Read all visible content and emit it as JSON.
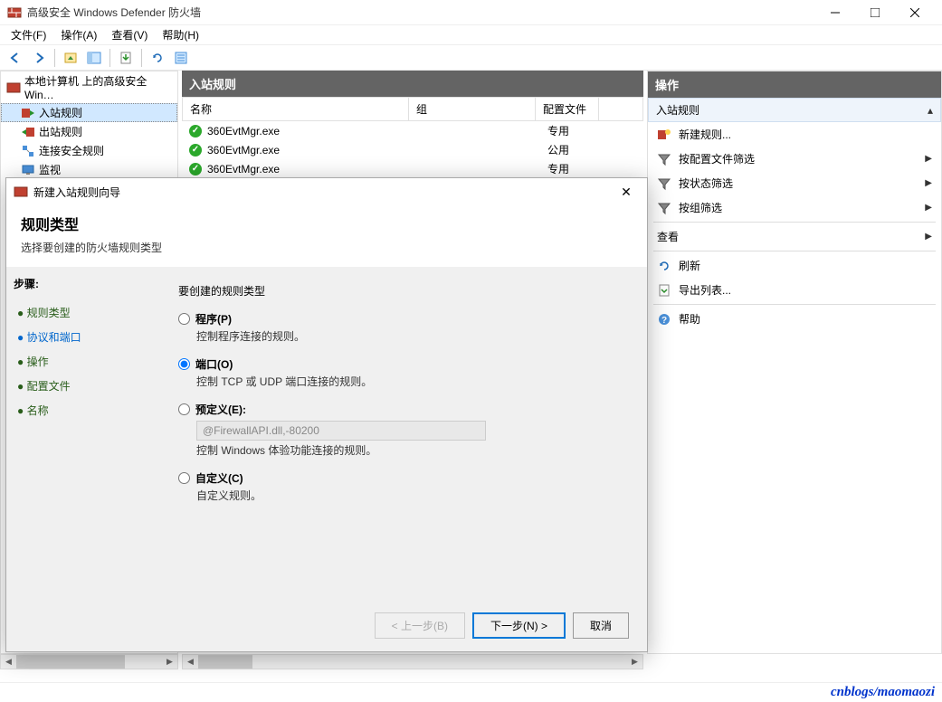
{
  "window": {
    "title": "高级安全 Windows Defender 防火墙"
  },
  "menu": {
    "file": "文件(F)",
    "action": "操作(A)",
    "view": "查看(V)",
    "help": "帮助(H)"
  },
  "tree": {
    "root": "本地计算机 上的高级安全 Win…",
    "inbound": "入站规则",
    "outbound": "出站规则",
    "connsec": "连接安全规则",
    "monitor": "监视"
  },
  "center": {
    "header": "入站规则",
    "cols": {
      "name": "名称",
      "group": "组",
      "profile": "配置文件"
    },
    "rows": [
      {
        "name": "360EvtMgr.exe",
        "group": "",
        "profile": "专用"
      },
      {
        "name": "360EvtMgr.exe",
        "group": "",
        "profile": "公用"
      },
      {
        "name": "360EvtMgr.exe",
        "group": "",
        "profile": "专用"
      }
    ]
  },
  "actions": {
    "header": "操作",
    "section": "入站规则",
    "items": {
      "newrule": "新建规则...",
      "filterprofile": "按配置文件筛选",
      "filterstate": "按状态筛选",
      "filtergroup": "按组筛选",
      "view": "查看",
      "refresh": "刷新",
      "export": "导出列表...",
      "help": "帮助"
    }
  },
  "wizard": {
    "title": "新建入站规则向导",
    "heading": "规则类型",
    "subheading": "选择要创建的防火墙规则类型",
    "steps_label": "步骤:",
    "steps": {
      "ruletype": "规则类型",
      "protocol": "协议和端口",
      "operation": "操作",
      "profile": "配置文件",
      "name": "名称"
    },
    "prompt": "要创建的规则类型",
    "options": {
      "program": {
        "label": "程序(P)",
        "desc": "控制程序连接的规则。"
      },
      "port": {
        "label": "端口(O)",
        "desc": "控制 TCP 或 UDP 端口连接的规则。"
      },
      "predefined": {
        "label": "预定义(E):",
        "dropdown": "@FirewallAPI.dll,-80200",
        "desc": "控制 Windows 体验功能连接的规则。"
      },
      "custom": {
        "label": "自定义(C)",
        "desc": "自定义规则。"
      }
    },
    "buttons": {
      "back": "< 上一步(B)",
      "next": "下一步(N) >",
      "cancel": "取消"
    }
  },
  "watermark": "cnblogs/maomaozi"
}
